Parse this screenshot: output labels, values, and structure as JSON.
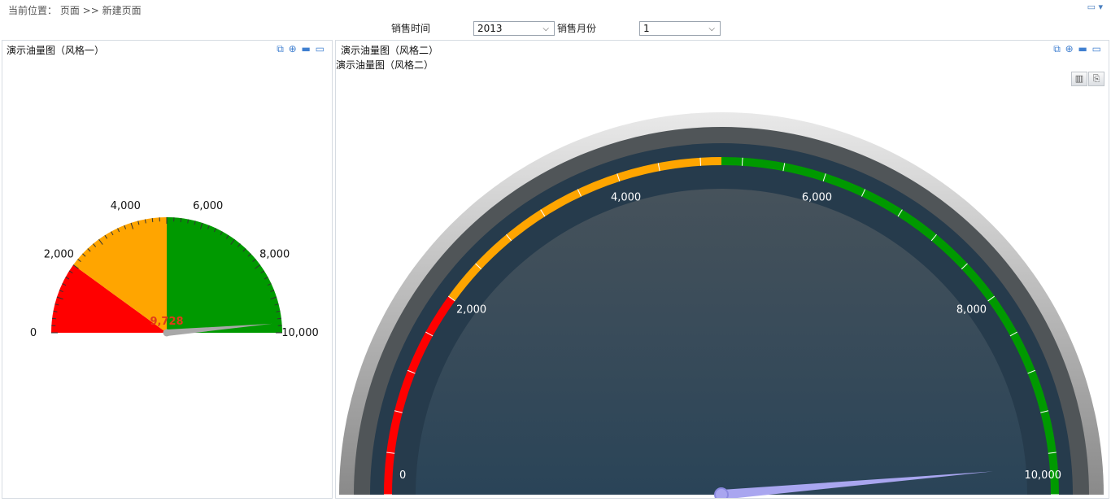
{
  "breadcrumb": {
    "prefix": "当前位置：",
    "path": "页面 >> 新建页面"
  },
  "top_tools": {
    "minimize_glyph": "▭",
    "menu_glyph": "▾"
  },
  "filters": {
    "sales_time_label": "销售时间",
    "sales_time_value": "2013",
    "sales_month_label": "销售月份",
    "sales_month_value": "1"
  },
  "panel_left": {
    "title": "演示油量图（风格一）",
    "tools": "⧉ ⊕ ▬ ▭"
  },
  "panel_right": {
    "title": "演示油量图（风格二）",
    "subtitle": "演示油量图（风格二）",
    "tools": "⧉ ⊕ ▬ ▭",
    "chart_btn": "▥",
    "export_btn": "⎘"
  },
  "chart_data": [
    {
      "type": "gauge",
      "min": 0,
      "max": 10000,
      "value": 9728,
      "value_label": "9,728",
      "tick_labels": [
        "0",
        "2,000",
        "4,000",
        "6,000",
        "8,000",
        "10,000"
      ],
      "bands": [
        {
          "from": 0,
          "to": 2000,
          "color": "#ff0000"
        },
        {
          "from": 2000,
          "to": 5000,
          "color": "#ffa500"
        },
        {
          "from": 5000,
          "to": 10000,
          "color": "#009900"
        }
      ]
    },
    {
      "type": "gauge",
      "min": 0,
      "max": 10000,
      "value": 9728,
      "tick_labels": [
        "0",
        "2,000",
        "4,000",
        "6,000",
        "8,000",
        "10,000"
      ],
      "bands": [
        {
          "from": 0,
          "to": 2000,
          "color": "#ff0000"
        },
        {
          "from": 2000,
          "to": 5000,
          "color": "#ffa500"
        },
        {
          "from": 5000,
          "to": 10000,
          "color": "#009900"
        }
      ]
    }
  ]
}
